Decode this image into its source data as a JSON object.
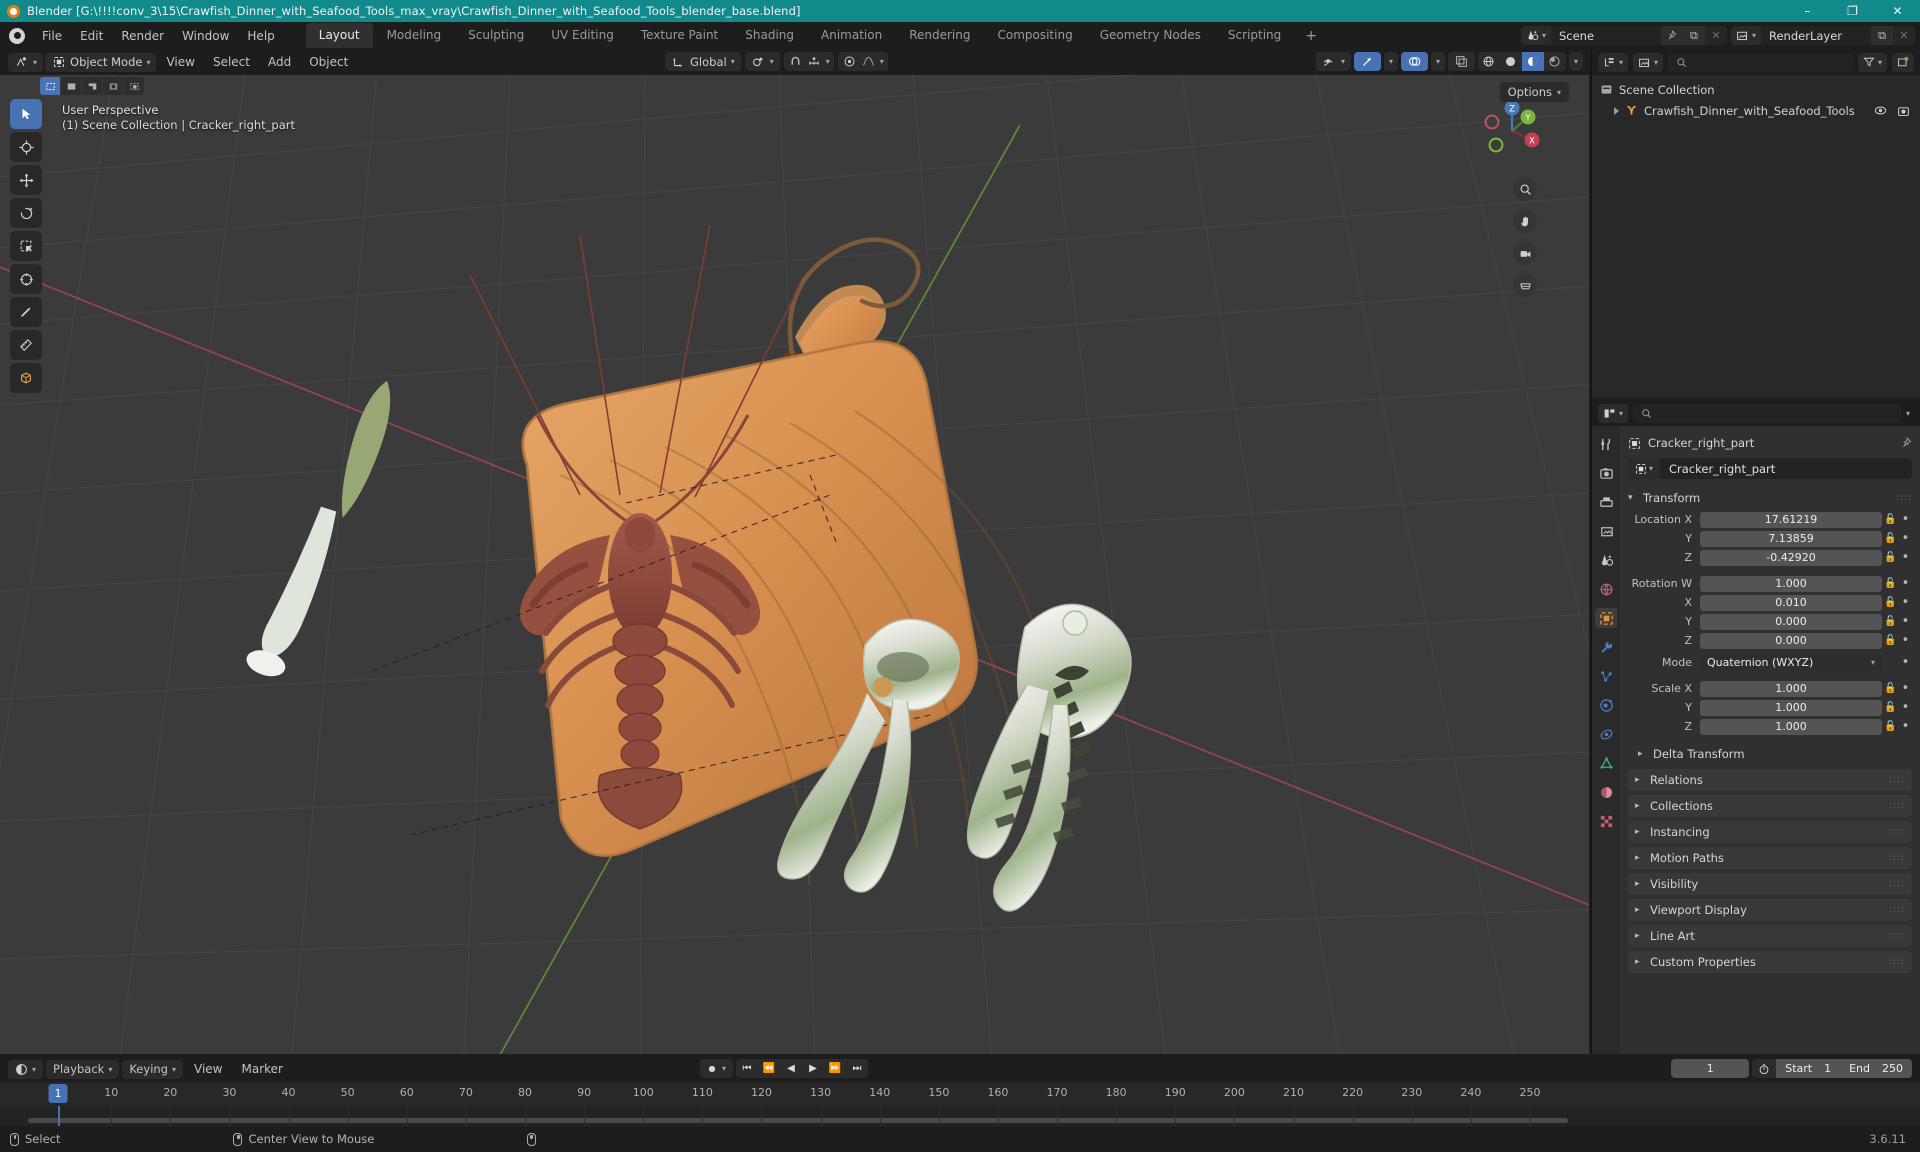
{
  "window": {
    "title": "Blender [G:\\!!!!conv_3\\15\\Crawfish_Dinner_with_Seafood_Tools_max_vray\\Crawfish_Dinner_with_Seafood_Tools_blender_base.blend]",
    "minimize": "–",
    "maximize": "❐",
    "close": "✕"
  },
  "topbar": {
    "menus": [
      "File",
      "Edit",
      "Render",
      "Window",
      "Help"
    ],
    "workspace_tabs": [
      {
        "label": "Layout",
        "active": true
      },
      {
        "label": "Modeling",
        "active": false
      },
      {
        "label": "Sculpting",
        "active": false
      },
      {
        "label": "UV Editing",
        "active": false
      },
      {
        "label": "Texture Paint",
        "active": false
      },
      {
        "label": "Shading",
        "active": false
      },
      {
        "label": "Animation",
        "active": false
      },
      {
        "label": "Rendering",
        "active": false
      },
      {
        "label": "Compositing",
        "active": false
      },
      {
        "label": "Geometry Nodes",
        "active": false
      },
      {
        "label": "Scripting",
        "active": false
      }
    ],
    "add_tab": "+",
    "scene": {
      "name": "Scene",
      "new_btn": "⧉",
      "unlink_btn": "✕"
    },
    "viewlayer": {
      "name": "RenderLayer",
      "new_btn": "⧉",
      "unlink_btn": "✕"
    }
  },
  "viewport": {
    "mode": "Object Mode",
    "menus": [
      "View",
      "Select",
      "Add",
      "Object"
    ],
    "transform_orientation": "Global",
    "options_label": "Options",
    "overlay_line1": "User Perspective",
    "overlay_line2": "(1) Scene Collection | Cracker_right_part",
    "gizmo_axes": {
      "x": "X",
      "y": "Y",
      "z": "Z"
    }
  },
  "outliner": {
    "search_placeholder": "",
    "rows": [
      {
        "label": "Scene Collection",
        "level": 0,
        "icon": "collection-icon",
        "expandable": false
      },
      {
        "label": "Crawfish_Dinner_with_Seafood_Tools",
        "level": 1,
        "icon": "mesh-data-icon",
        "expandable": true
      }
    ]
  },
  "properties": {
    "search_placeholder": "",
    "breadcrumb": "Cracker_right_part",
    "object_name": "Cracker_right_part",
    "transform_panel": "Transform",
    "rows": [
      {
        "label": "Location X",
        "value": "17.61219"
      },
      {
        "label": "Y",
        "value": "7.13859"
      },
      {
        "label": "Z",
        "value": "-0.42920"
      }
    ],
    "rotation_rows": [
      {
        "label": "Rotation W",
        "value": "1.000"
      },
      {
        "label": "X",
        "value": "0.010"
      },
      {
        "label": "Y",
        "value": "0.000"
      },
      {
        "label": "Z",
        "value": "0.000"
      }
    ],
    "mode_label": "Mode",
    "mode_value": "Quaternion (WXYZ)",
    "scale_rows": [
      {
        "label": "Scale X",
        "value": "1.000"
      },
      {
        "label": "Y",
        "value": "1.000"
      },
      {
        "label": "Z",
        "value": "1.000"
      }
    ],
    "delta_transform": "Delta Transform",
    "panels": [
      "Relations",
      "Collections",
      "Instancing",
      "Motion Paths",
      "Visibility",
      "Viewport Display",
      "Line Art",
      "Custom Properties"
    ]
  },
  "timeline": {
    "menus": [
      "Playback",
      "Keying",
      "View",
      "Marker"
    ],
    "current_frame": "1",
    "start_label": "Start",
    "start_value": "1",
    "end_label": "End",
    "end_value": "250",
    "ticks": [
      10,
      20,
      30,
      40,
      50,
      60,
      70,
      80,
      90,
      100,
      110,
      120,
      130,
      140,
      150,
      160,
      170,
      180,
      190,
      200,
      210,
      220,
      230,
      240,
      250
    ],
    "playhead_frame": "1"
  },
  "statusbar": {
    "items": [
      {
        "label": "Select",
        "mouse": "left"
      },
      {
        "label": "Center View to Mouse",
        "mouse": "middle"
      },
      {
        "label": "",
        "mouse": "right"
      }
    ],
    "version": "3.6.11"
  },
  "colors": {
    "accent_blue": "#4772b3",
    "title_teal": "#128a8c",
    "orange": "#e87d0d",
    "grid_bg": "#3b3b3b"
  }
}
